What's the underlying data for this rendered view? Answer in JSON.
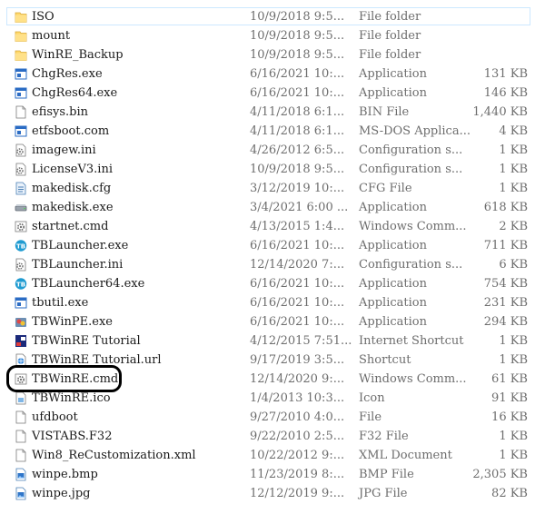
{
  "files": [
    {
      "name": "ISO",
      "date": "10/9/2018 9:5...",
      "type": "File folder",
      "size": "",
      "icon": "folder-icon",
      "selected": true
    },
    {
      "name": "mount",
      "date": "10/9/2018 9:5...",
      "type": "File folder",
      "size": "",
      "icon": "folder-icon"
    },
    {
      "name": "WinRE_Backup",
      "date": "10/9/2018 9:5...",
      "type": "File folder",
      "size": "",
      "icon": "folder-icon"
    },
    {
      "name": "ChgRes.exe",
      "date": "6/16/2021 10:...",
      "type": "Application",
      "size": "131 KB",
      "icon": "exe-window-icon"
    },
    {
      "name": "ChgRes64.exe",
      "date": "6/16/2021 10:...",
      "type": "Application",
      "size": "146 KB",
      "icon": "exe-window-icon"
    },
    {
      "name": "efisys.bin",
      "date": "4/11/2018 6:1...",
      "type": "BIN File",
      "size": "1,440 KB",
      "icon": "blank-file-icon"
    },
    {
      "name": "etfsboot.com",
      "date": "4/11/2018 6:1...",
      "type": "MS-DOS Applica...",
      "size": "4 KB",
      "icon": "exe-window-icon"
    },
    {
      "name": "imagew.ini",
      "date": "4/26/2012 6:5...",
      "type": "Configuration s...",
      "size": "1 KB",
      "icon": "config-file-icon"
    },
    {
      "name": "LicenseV3.ini",
      "date": "10/9/2018 9:5...",
      "type": "Configuration s...",
      "size": "1 KB",
      "icon": "config-file-icon"
    },
    {
      "name": "makedisk.cfg",
      "date": "3/12/2019 10:...",
      "type": "CFG File",
      "size": "1 KB",
      "icon": "cfg-file-icon"
    },
    {
      "name": "makedisk.exe",
      "date": "3/4/2021 6:00 ...",
      "type": "Application",
      "size": "618 KB",
      "icon": "disk-drive-icon"
    },
    {
      "name": "startnet.cmd",
      "date": "4/13/2015 1:4...",
      "type": "Windows Comm...",
      "size": "2 KB",
      "icon": "cmd-gear-icon"
    },
    {
      "name": "TBLauncher.exe",
      "date": "6/16/2021 10:...",
      "type": "Application",
      "size": "711 KB",
      "icon": "tb-launcher-icon"
    },
    {
      "name": "TBLauncher.ini",
      "date": "12/14/2020 7:...",
      "type": "Configuration s...",
      "size": "6 KB",
      "icon": "config-file-icon"
    },
    {
      "name": "TBLauncher64.exe",
      "date": "6/16/2021 10:...",
      "type": "Application",
      "size": "754 KB",
      "icon": "tb-launcher-icon"
    },
    {
      "name": "tbutil.exe",
      "date": "6/16/2021 10:...",
      "type": "Application",
      "size": "231 KB",
      "icon": "exe-window-icon"
    },
    {
      "name": "TBWinPE.exe",
      "date": "6/16/2021 10:...",
      "type": "Application",
      "size": "294 KB",
      "icon": "tbwinpe-icon"
    },
    {
      "name": "TBWinRE Tutorial",
      "date": "4/12/2015 7:51...",
      "type": "Internet Shortcut",
      "size": "1 KB",
      "icon": "tutorial-shortcut-icon"
    },
    {
      "name": "TBWinRE Tutorial.url",
      "date": "9/17/2019 3:5...",
      "type": "Shortcut",
      "size": "1 KB",
      "icon": "url-shortcut-icon"
    },
    {
      "name": "TBWinRE.cmd",
      "date": "12/14/2020 9:...",
      "type": "Windows Comm...",
      "size": "61 KB",
      "icon": "cmd-gear-icon"
    },
    {
      "name": "TBWinRE.ico",
      "date": "1/4/2013 10:3...",
      "type": "Icon",
      "size": "91 KB",
      "icon": "ico-file-icon"
    },
    {
      "name": "ufdboot",
      "date": "9/27/2010 4:0...",
      "type": "File",
      "size": "16 KB",
      "icon": "blank-file-icon"
    },
    {
      "name": "VISTABS.F32",
      "date": "9/22/2010 2:5...",
      "type": "F32 File",
      "size": "1 KB",
      "icon": "blank-file-icon"
    },
    {
      "name": "Win8_ReCustomization.xml",
      "date": "10/22/2012 9:...",
      "type": "XML Document",
      "size": "1 KB",
      "icon": "blank-file-icon"
    },
    {
      "name": "winpe.bmp",
      "date": "11/23/2019 8:...",
      "type": "BMP File",
      "size": "2,305 KB",
      "icon": "image-file-icon"
    },
    {
      "name": "winpe.jpg",
      "date": "12/12/2019 9:...",
      "type": "JPG File",
      "size": "82 KB",
      "icon": "image-file-icon"
    }
  ],
  "colors": {
    "folder": "#ffd86a",
    "selection_border": "#cce8ff",
    "detail_text": "#6d6d6d",
    "callout": "#000000",
    "exe_blue": "#2b6cc4"
  }
}
